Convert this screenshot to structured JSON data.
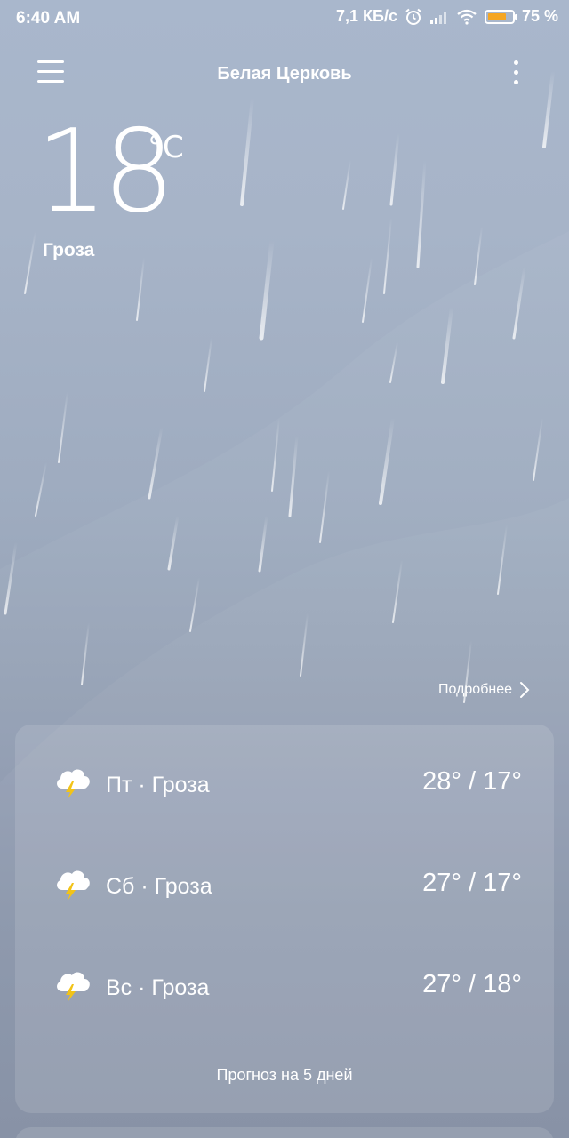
{
  "status_bar": {
    "time": "6:40 AM",
    "network_speed": "7,1 КБ/с",
    "battery_percent": "75 %",
    "battery_level": 0.75,
    "icons": [
      "alarm-icon",
      "signal-icon",
      "wifi-icon",
      "battery-icon"
    ]
  },
  "header": {
    "city": "Белая Церковь",
    "menu_icon": "hamburger-menu-icon",
    "more_icon": "more-vertical-icon"
  },
  "current": {
    "temperature": "18",
    "unit": "°C",
    "condition": "Гроза"
  },
  "details_link": "Подробнее",
  "forecast": {
    "days": [
      {
        "label": "Пт · Гроза",
        "temps": "28° / 17°",
        "icon": "thunderstorm-icon"
      },
      {
        "label": "Сб · Гроза",
        "temps": "27° / 17°",
        "icon": "thunderstorm-icon"
      },
      {
        "label": "Вс · Гроза",
        "temps": "27° / 18°",
        "icon": "thunderstorm-icon"
      }
    ],
    "footer": "Прогноз на 5 дней"
  },
  "colors": {
    "battery_fill": "#f5a623",
    "lightning": "#f2c318"
  }
}
